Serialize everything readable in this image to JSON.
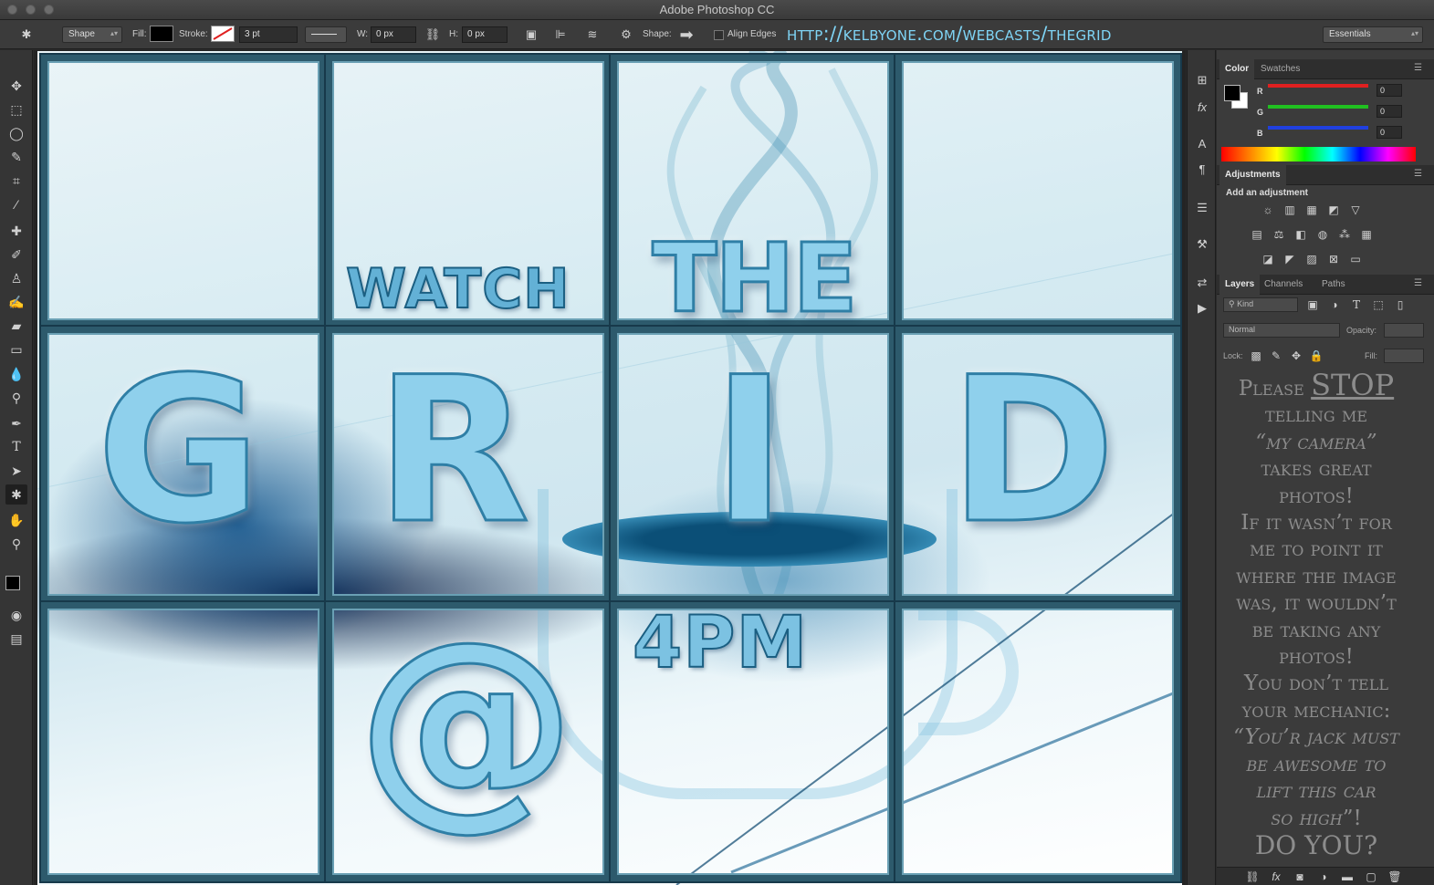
{
  "app": {
    "title": "Adobe Photoshop CC"
  },
  "options": {
    "tool_mode": "Shape",
    "fill_label": "Fill:",
    "stroke_label": "Stroke:",
    "stroke_width": "3 pt",
    "w_label": "W:",
    "w_value": "0 px",
    "h_label": "H:",
    "h_value": "0 px",
    "shape_label": "Shape:",
    "align_edges": "Align Edges",
    "workspace": "Essentials"
  },
  "overlay": {
    "url": "http://kelbyone.com/webcasts/thegrid"
  },
  "canvas": {
    "word_watch": "WATCH",
    "word_the": "THE",
    "letters": [
      "G",
      "R",
      "I",
      "D"
    ],
    "at": "@",
    "time": "4PM"
  },
  "color_panel": {
    "tabs": [
      "Color",
      "Swatches"
    ],
    "channels": [
      {
        "label": "R",
        "value": "0",
        "color": "#e02020"
      },
      {
        "label": "G",
        "value": "0",
        "color": "#20c020"
      },
      {
        "label": "B",
        "value": "0",
        "color": "#2040e0"
      }
    ]
  },
  "adjustments": {
    "tab": "Adjustments",
    "heading": "Add an adjustment"
  },
  "layers": {
    "tabs": [
      "Layers",
      "Channels",
      "Paths"
    ],
    "kind": "Kind",
    "blend": "Normal",
    "opacity_label": "Opacity:",
    "lock_label": "Lock:",
    "fill_label": "Fill:"
  },
  "quote": {
    "l1a": "Please ",
    "l1b": "STOP",
    "l2": "telling me",
    "l3": "“my camera”",
    "l4": "takes great",
    "l5": "photos!",
    "l6": "If it wasn’t for",
    "l7": "me to point it",
    "l8": "where the image",
    "l9": "was, it wouldn’t",
    "l10": "be taking any",
    "l11": "photos!",
    "l12": "You don’t tell",
    "l13": "your mechanic:",
    "l14": "“You’r jack must",
    "l15": "be awesome to",
    "l16": "lift this car",
    "l17a": "so high",
    "l17b": "”!",
    "l18": "DO YOU?"
  }
}
